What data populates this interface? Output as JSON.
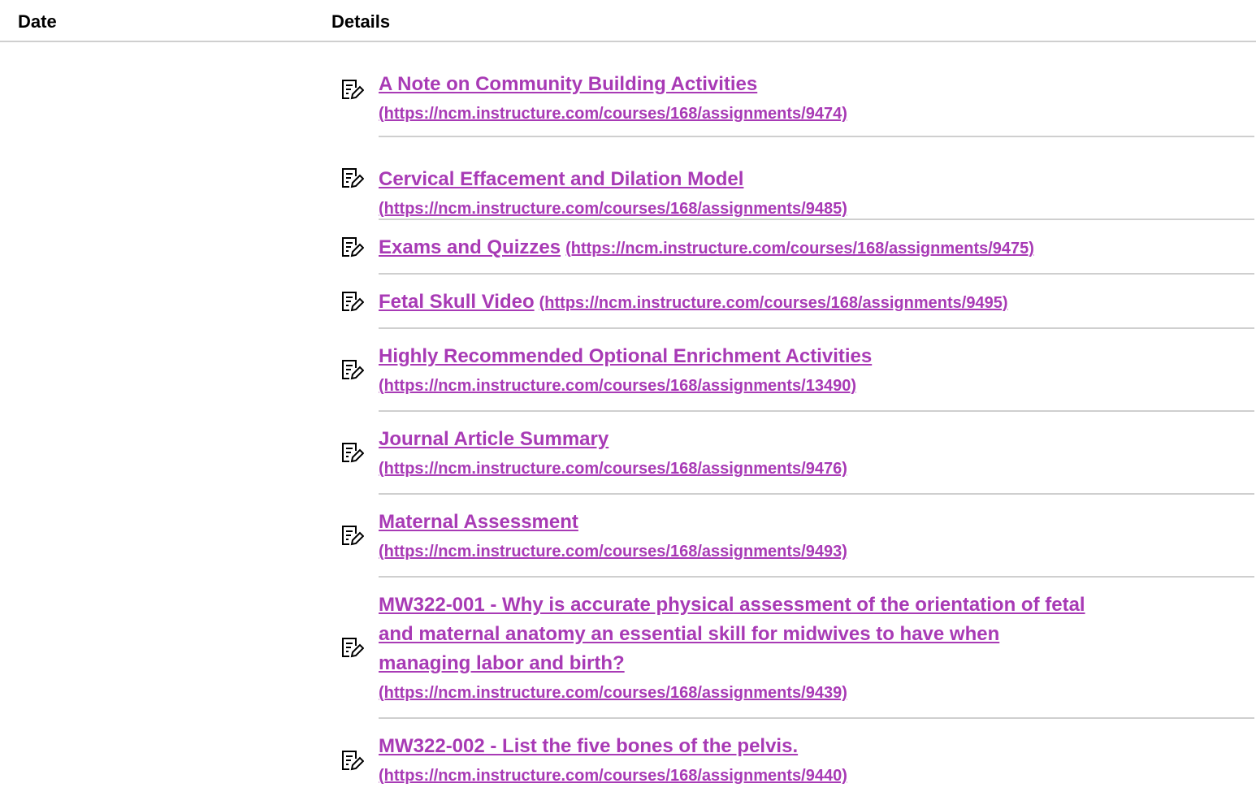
{
  "header": {
    "date_label": "Date",
    "details_label": "Details"
  },
  "colors": {
    "link": "#a83ab5",
    "divider": "#cfcfcf"
  },
  "items": [
    {
      "icon": "assignment-icon",
      "title": "A Note on Community Building Activities",
      "url": "(https://ncm.instructure.com/courses/168/assignments/9474)"
    },
    {
      "icon": "assignment-icon",
      "title": "Cervical Effacement and Dilation Model",
      "url": "(https://ncm.instructure.com/courses/168/assignments/9485)"
    },
    {
      "icon": "assignment-icon",
      "title": "Exams and Quizzes",
      "url": "(https://ncm.instructure.com/courses/168/assignments/9475)"
    },
    {
      "icon": "assignment-icon",
      "title": "Fetal Skull Video",
      "url": "(https://ncm.instructure.com/courses/168/assignments/9495)"
    },
    {
      "icon": "assignment-icon",
      "title": "Highly Recommended Optional Enrichment Activities",
      "url": "(https://ncm.instructure.com/courses/168/assignments/13490)"
    },
    {
      "icon": "assignment-icon",
      "title": "Journal Article Summary",
      "url": "(https://ncm.instructure.com/courses/168/assignments/9476)"
    },
    {
      "icon": "assignment-icon",
      "title": "Maternal Assessment",
      "url": "(https://ncm.instructure.com/courses/168/assignments/9493)"
    },
    {
      "icon": "assignment-icon",
      "title_lines": [
        "MW322-001 - Why is accurate physical assessment of the orientation of fetal",
        "and maternal anatomy an essential skill for midwives to have when",
        "managing labor and birth?"
      ],
      "url": "(https://ncm.instructure.com/courses/168/assignments/9439)"
    },
    {
      "icon": "assignment-icon",
      "title": "MW322-002 - List the five bones of the pelvis.",
      "url": "(https://ncm.instructure.com/courses/168/assignments/9440)"
    }
  ]
}
